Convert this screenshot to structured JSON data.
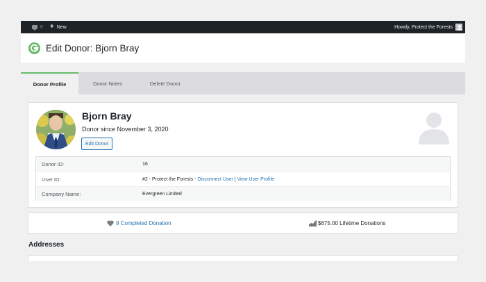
{
  "admin_bar": {
    "comment_count": "0",
    "new_label": "New",
    "howdy_text": "Howdy, Protect the Forests"
  },
  "header": {
    "title": "Edit Donor: Bjorn Bray",
    "logo_icon": "givewp-logo-icon"
  },
  "tabs": [
    {
      "label": "Donor Profile",
      "active": true
    },
    {
      "label": "Donor Notes",
      "active": false
    },
    {
      "label": "Delete Donor",
      "active": false
    }
  ],
  "profile": {
    "name": "Bjorn Bray",
    "since": "Donor since November 3, 2020",
    "edit_button": "Edit Donor",
    "fields": [
      {
        "label": "Donor ID:",
        "value": "16"
      },
      {
        "label": "User ID:",
        "value": "#2 - Protect the Forests - ",
        "disconnect_link": "Disconnect User",
        "separator": " | ",
        "view_link": "View User Profile"
      },
      {
        "label": "Company Name:",
        "value": "Evergreen Limited"
      }
    ]
  },
  "stats": {
    "completed": "9 Completed Donation",
    "lifetime": "$675.00 Lifetime Donations"
  },
  "addresses": {
    "title": "Addresses"
  },
  "colors": {
    "accent_green": "#66bb6a",
    "link_blue": "#2271b1",
    "admin_bar": "#1d2327"
  }
}
